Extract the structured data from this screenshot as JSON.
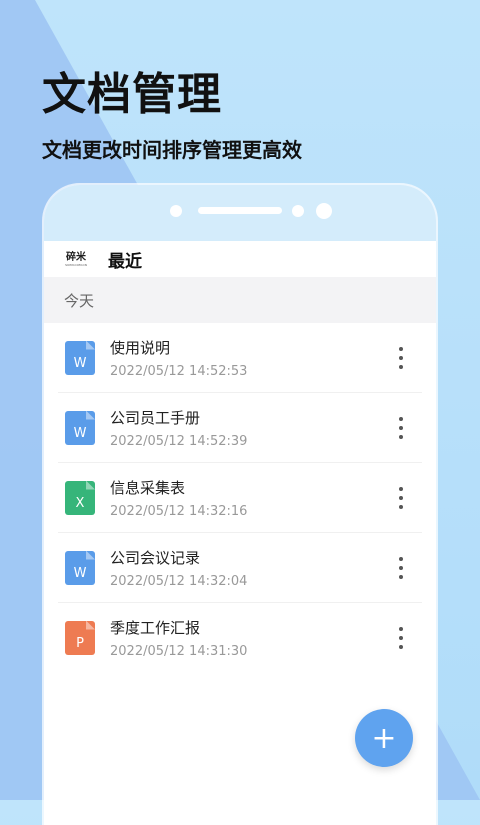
{
  "promo": {
    "headline": "文档管理",
    "subline": "文档更改时间排序管理更高效"
  },
  "appbar": {
    "logo_text": "碎米",
    "logo_subtext": "SUIMI.COM.CN",
    "title": "最近"
  },
  "section": {
    "label": "今天"
  },
  "files": [
    {
      "name": "使用说明",
      "date": "2022/05/12 14:52:53",
      "type_letter": "W",
      "type": "word"
    },
    {
      "name": "公司员工手册",
      "date": "2022/05/12 14:52:39",
      "type_letter": "W",
      "type": "word"
    },
    {
      "name": "信息采集表",
      "date": "2022/05/12 14:32:16",
      "type_letter": "X",
      "type": "excel"
    },
    {
      "name": "公司会议记录",
      "date": "2022/05/12 14:32:04",
      "type_letter": "W",
      "type": "word"
    },
    {
      "name": "季度工作汇报",
      "date": "2022/05/12 14:31:30",
      "type_letter": "P",
      "type": "powerpoint"
    }
  ],
  "fab": {
    "icon": "plus-icon",
    "symbol": "+"
  },
  "colors": {
    "word": "#5a9ce9",
    "excel": "#36b57a",
    "powerpoint": "#ee7b52",
    "accent": "#5fa3ef"
  }
}
